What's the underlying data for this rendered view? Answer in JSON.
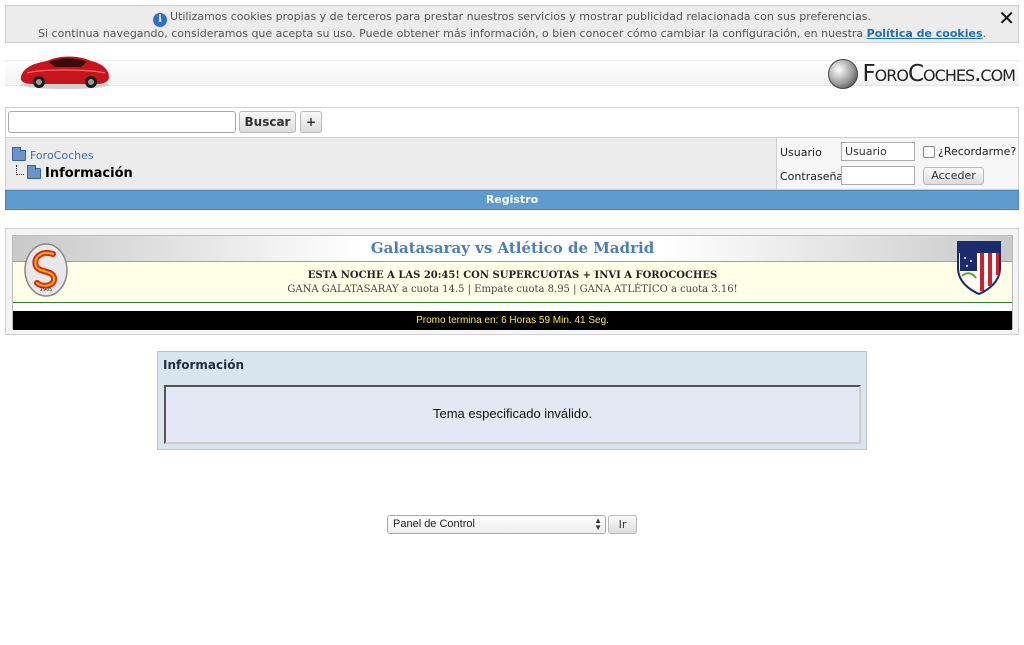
{
  "cookie": {
    "line1": "Utilizamos cookies propias y de terceros para prestar nuestros servicios y mostrar publicidad relacionada con sus preferencias.",
    "line2": "Si continua navegando, consideramos que acepta su uso. Puede obtener más información, o bien conocer cómo cambiar la configuración, en nuestra",
    "link": "Política de cookies",
    "period": ".",
    "close": "✕"
  },
  "header": {
    "brand": "ForoCoches.com"
  },
  "search": {
    "value": "",
    "button": "Buscar",
    "plus": "+"
  },
  "breadcrumb": {
    "home": "ForoCoches",
    "current": "Información"
  },
  "login": {
    "user_label": "Usuario",
    "user_value": "Usuario",
    "pass_label": "Contraseña",
    "remember": "¿Recordarme?",
    "button": "Acceder"
  },
  "registro": "Registro",
  "promo": {
    "title": "Galatasaray vs Atlético de Madrid",
    "line1": "ESTA NOCHE A LAS 20:45! CON SUPERCUOTAS + INVI A FOROCOCHES",
    "line2": "GANA GALATASARAY a cuota 14.5 | Empate cuota 8.95 | GANA ATLÉTICO a cuota 3.16!",
    "timer": "Promo termina en: 6 Horas 59 Min. 41 Seg.",
    "crest_year": "1905"
  },
  "info": {
    "title": "Información",
    "message": "Tema especificado inválido."
  },
  "footer": {
    "select": "Panel de Control",
    "go": "Ir"
  },
  "colors": {
    "registro_bar": "#5e9ccf",
    "link": "#3a6fae",
    "promo_title": "#4b7fba",
    "timer_text": "#ffe84d"
  }
}
